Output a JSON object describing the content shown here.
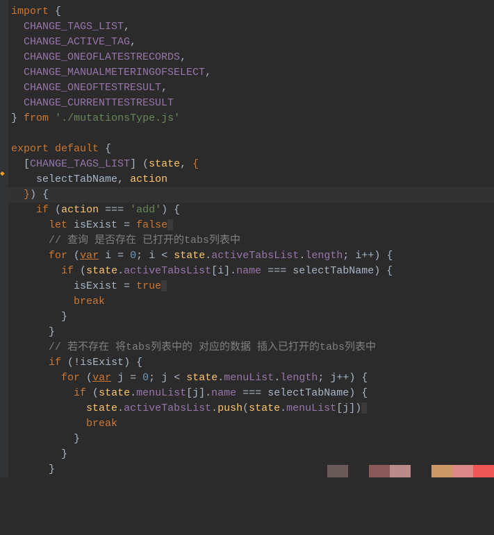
{
  "imports": {
    "keyword_import": "import",
    "items": [
      "CHANGE_TAGS_LIST",
      "CHANGE_ACTIVE_TAG",
      "CHANGE_ONEOFLATESTRECORDS",
      "CHANGE_MANUALMETERINGOFSELECT",
      "CHANGE_ONEOFTESTRESULT",
      "CHANGE_CURRENTTESTRESULT"
    ],
    "keyword_from": "from",
    "source": "'./mutationsType.js'"
  },
  "export": {
    "keyword_export": "export",
    "keyword_default": "default",
    "computed_key": "CHANGE_TAGS_LIST",
    "param_state": "state",
    "destructure": {
      "selectTabName": "selectTabName",
      "action": "action"
    }
  },
  "body": {
    "if1_cond_lhs": "action",
    "if1_cond_op": "===",
    "if1_cond_rhs": "'add'",
    "let_kw": "let",
    "isExist": "isExist",
    "false_kw": "false",
    "comment1": "// 查询 是否存在 已打开的tabs列表中",
    "for_kw": "for",
    "var_kw": "var",
    "i": "i",
    "zero": "0",
    "state": "state",
    "activeTabsList": "activeTabsList",
    "length": "length",
    "ipp": "i++",
    "name": "name",
    "selectTabName": "selectTabName",
    "true_kw": "true",
    "break_kw": "break",
    "comment2": "// 若不存在 将tabs列表中的 对应的数据 插入已打开的tabs列表中",
    "if_kw": "if",
    "not_isExist": "!isExist",
    "j": "j",
    "menuList": "menuList",
    "jpp": "j++",
    "push": "push"
  }
}
